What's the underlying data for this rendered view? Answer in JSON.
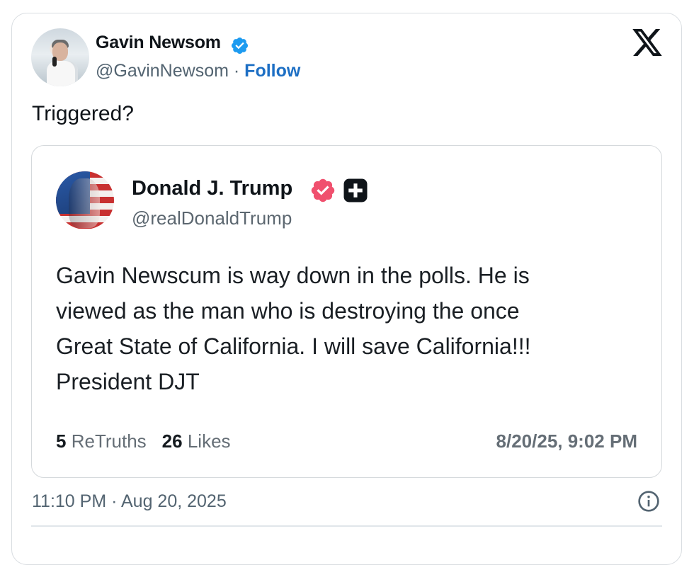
{
  "author": {
    "name": "Gavin Newsom",
    "handle": "@GavinNewsom",
    "separator": "·",
    "follow_label": "Follow"
  },
  "tweet": {
    "text": "Triggered?",
    "timestamp": "11:10 PM · Aug 20, 2025"
  },
  "quoted_post": {
    "name": "Donald J. Trump",
    "handle": "@realDonaldTrump",
    "body_lines": [
      "Gavin Newscum is way down in the polls. He is",
      "viewed as the man who is destroying the once",
      "Great State of California. I will save California!!!",
      "President DJT"
    ],
    "retruths_count": "5",
    "retruths_label": "ReTruths",
    "likes_count": "26",
    "likes_label": "Likes",
    "timestamp": "8/20/25, 9:02 PM"
  },
  "icons": {
    "verified": "verified-badge-icon",
    "x_logo": "x-logo-icon",
    "truth_verified": "truth-verified-badge-icon",
    "plus": "plus-badge-icon",
    "info": "info-icon"
  },
  "colors": {
    "follow": "#1d6fc4",
    "verified_blue": "#1d9bf0",
    "truth_badge": "#f0506e",
    "secondary_text": "#536471"
  }
}
